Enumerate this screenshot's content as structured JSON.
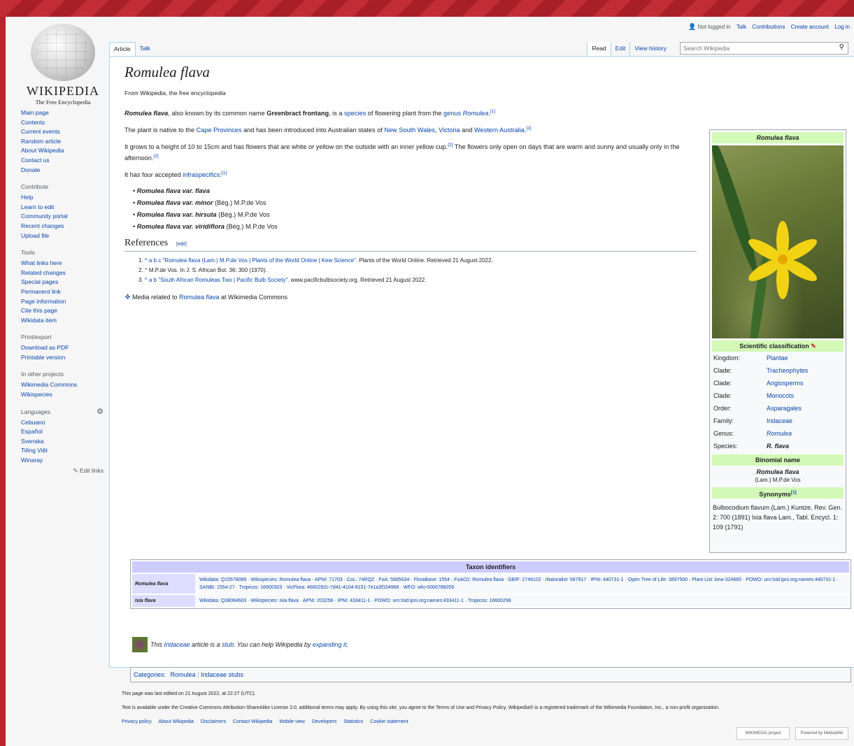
{
  "site": {
    "wordmark": "WIKIPEDIA",
    "tagline": "The Free Encyclopedia"
  },
  "personal": {
    "status": "Not logged in",
    "links": [
      "Talk",
      "Contributions",
      "Create account",
      "Log in"
    ]
  },
  "tabs": {
    "left": [
      "Article",
      "Talk"
    ],
    "right": [
      "Read",
      "Edit",
      "View history"
    ],
    "selected": "Article"
  },
  "search": {
    "placeholder": "Search Wikipedia"
  },
  "sidebar": {
    "main": [
      "Main page",
      "Contents",
      "Current events",
      "Random article",
      "About Wikipedia",
      "Contact us",
      "Donate"
    ],
    "contribute": {
      "heading": "Contribute",
      "items": [
        "Help",
        "Learn to edit",
        "Community portal",
        "Recent changes",
        "Upload file"
      ]
    },
    "tools": {
      "heading": "Tools",
      "items": [
        "What links here",
        "Related changes",
        "Special pages",
        "Permanent link",
        "Page information",
        "Cite this page",
        "Wikidata item"
      ]
    },
    "print": {
      "heading": "Print/export",
      "items": [
        "Download as PDF",
        "Printable version"
      ]
    },
    "other": {
      "heading": "In other projects",
      "items": [
        "Wikimedia Commons",
        "Wikispecies"
      ]
    },
    "languages": {
      "heading": "Languages",
      "items": [
        "Cebuano",
        "Español",
        "Svenska",
        "Tiếng Việt",
        "Winaray"
      ],
      "edit_links": "Edit links"
    }
  },
  "article": {
    "title": "Romulea flava",
    "tagline": "From Wikipedia, the free encyclopedia",
    "p1": {
      "name": "Romulea flava",
      "text1": ", also known by its common name ",
      "common": "Greenbract frontang",
      "text2": ", is a ",
      "link1": "species",
      "text3": " of flowering plant from the ",
      "link2": "genus",
      "link3": "Romulea",
      "ref": "[1]"
    },
    "p2": {
      "text1": "The plant is native to the ",
      "link1": "Cape Provinces",
      "text2": " and has been introduced into Australian states of ",
      "link2": "New South Wales",
      "link3": "Victoria",
      "text3": " and ",
      "link4": "Western Australia",
      "ref": "[1]"
    },
    "p3": {
      "text": "It grows to a height of 10 to 15cm and has flowers that are white or yellow on the outside with an inner yellow cup.",
      "ref1": "[2]",
      "text2": " The flowers only open on days that are warm and sunny and usually only in the afternoon.",
      "ref2": "[2]"
    },
    "p4": {
      "text": "It has four accepted ",
      "link": "infraspecifics",
      "ref": "[1]"
    },
    "infraspecifics": [
      {
        "name": "Romulea flava var. flava",
        "author": ""
      },
      {
        "name": "Romulea flava var. minor",
        "author": "(Bég.) M.P.de Vos"
      },
      {
        "name": "Romulea flava var. hirsuta",
        "author": "(Bég.) M.P.de Vos"
      },
      {
        "name": "Romulea flava var. viridiflora",
        "author": "(Bég.) M.P.de Vos"
      }
    ],
    "references_heading": "References",
    "edit_label": "edit",
    "references": [
      {
        "num": "1.",
        "back": "^ a b c",
        "link": "\"Romulea flava (Lam.) M.P.de Vos | Plants of the World Online | Kew Science\"",
        "rest": ". Plants of the World Online. Retrieved 21 August 2022."
      },
      {
        "num": "2.",
        "back": "^",
        "link": "",
        "rest": "M.P.de Vos. In J. S. African Bot. 36: 300 (1970)."
      },
      {
        "num": "3.",
        "back": "^ a b",
        "link": "\"South African Romuleas Two | Pacific Bulb Society\"",
        "rest": ". www.pacificbulbsociety.org. Retrieved 21 August 2022."
      }
    ],
    "commons": {
      "text1": "Media related to ",
      "link": "Romulea flava",
      "text2": " at Wikimedia Commons"
    }
  },
  "infobox": {
    "title": "Romulea flava",
    "classification_heading": "Scientific classification",
    "rows": [
      {
        "k": "Kingdom:",
        "v": "Plantae"
      },
      {
        "k": "Clade:",
        "v": "Tracheophytes"
      },
      {
        "k": "Clade:",
        "v": "Angiosperms"
      },
      {
        "k": "Clade:",
        "v": "Monocots"
      },
      {
        "k": "Order:",
        "v": "Asparagales"
      },
      {
        "k": "Family:",
        "v": "Iridaceae"
      },
      {
        "k": "Genus:",
        "v": "Romulea"
      },
      {
        "k": "Species:",
        "v": "R. flava"
      }
    ],
    "binomial_heading": "Binomial name",
    "binomial": "Romulea flava",
    "binomial_author": "(Lam.) M.P.de Vos",
    "synonyms_heading": "Synonyms",
    "synonyms_ref": "[1]",
    "synonyms": "Bulbocodium flavum (Lam.) Kuntze, Rev. Gen. 2: 700 (1891) Ixia flava Lam., Tabl. Encycl. 1: 109 (1791)"
  },
  "taxon": {
    "heading": "Taxon identifiers",
    "rows": [
      {
        "label": "Romulea flava",
        "values": "Wikidata: Q15578089 · Wikispecies: Romulea flava · APNI: 71703 · CoL: 74RQZ · FoA: 5685634 · FloraBase: 1554 · FoAO2: Romulea flava · GBIF: 2746102 · iNaturalist: 587917 · IPNI: 440731-1 · Open Tree of Life: 3897500 · Plant List: kew-324665 · POWO: urn:lsid:ipni.org:names:440731-1 · SANBI: 1554-27 · Tropicos: 16600303 · VicFlora: 4660292c-7d41-4104-8151-7e1a3f154966 · WFO: wfo-0000786059"
      },
      {
        "label": "Ixia flava",
        "values": "Wikidata: Q38084603 · Wikispecies: Ixia flava · APNI: 203256 · IPNI: 433411-1 · POWO: urn:lsid:ipni.org:names:433411-1 · Tropicos: 16600298"
      }
    ]
  },
  "stub": {
    "text1": "This ",
    "link1": "Iridaceae",
    "text2": " article is a ",
    "link2": "stub",
    "text3": ". You can help Wikipedia by ",
    "link3": "expanding it",
    "text4": "."
  },
  "categories": {
    "label": "Categories:",
    "items": [
      "Romulea",
      "Iridaceae stubs"
    ]
  },
  "footer": {
    "edited": "This page was last edited on 21 August 2022, at 22:27 (UTC).",
    "license": "Text is available under the Creative Commons Attribution-ShareAlike License 3.0; additional terms may apply. By using this site, you agree to the Terms of Use and Privacy Policy. Wikipedia® is a registered trademark of the Wikimedia Foundation, Inc., a non-profit organization.",
    "links": [
      "Privacy policy",
      "About Wikipedia",
      "Disclaimers",
      "Contact Wikipedia",
      "Mobile view",
      "Developers",
      "Statistics",
      "Cookie statement"
    ],
    "badges": [
      "WIKIMEDIA project",
      "Powered by MediaWiki"
    ]
  },
  "colors": {
    "link": "#0645ad",
    "infobox_header": "#d3f9b7",
    "taxon_header": "#ccccff",
    "frame": "#b8252d"
  },
  "icons": [
    "wikipedia-globe-icon",
    "user-icon",
    "search-icon",
    "gear-icon",
    "pencil-icon",
    "commons-icon",
    "stub-flower-icon"
  ]
}
